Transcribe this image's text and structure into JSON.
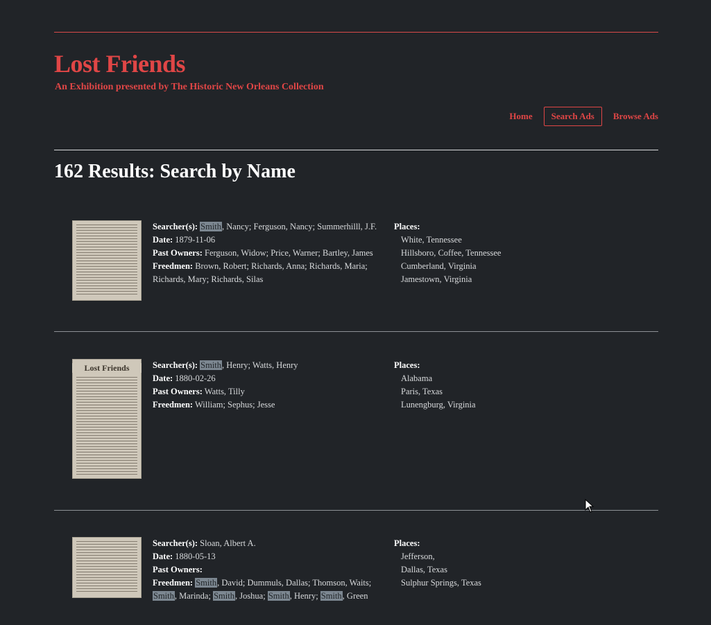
{
  "site": {
    "title": "Lost Friends",
    "subtitle": "An Exhibition presented by The Historic New Orleans Collection"
  },
  "nav": {
    "home": "Home",
    "search": "Search Ads",
    "browse": "Browse Ads"
  },
  "results_title": "162 Results: Search by Name",
  "labels": {
    "searchers": "Searcher(s):",
    "date": "Date:",
    "past_owners": "Past Owners:",
    "freedmen": "Freedmen:",
    "places": "Places:"
  },
  "results": [
    {
      "searchers_hl": "Smith",
      "searchers_rest": ", Nancy; Ferguson, Nancy; Summerhilll, J.F.",
      "date": "1879-11-06",
      "past_owners": "Ferguson, Widow; Price, Warner; Bartley, James",
      "freedmen_line1": "Brown, Robert; Richards, Anna; Richards, Maria;",
      "freedmen_line2": "Richards, Mary; Richards, Silas",
      "places": [
        "White, Tennessee",
        "Hillsboro, Coffee, Tennessee",
        "Cumberland, Virginia",
        "Jamestown, Virginia"
      ]
    },
    {
      "searchers_hl": "Smith",
      "searchers_rest": ", Henry; Watts, Henry",
      "date": "1880-02-26",
      "past_owners": "Watts, Tilly",
      "freedmen": "William; Sephus; Jesse",
      "places": [
        "Alabama",
        "Paris, Texas",
        "Lunengburg, Virginia"
      ],
      "thumb_header": "Lost Friends"
    },
    {
      "searchers": "Sloan, Albert A.",
      "date": "1880-05-13",
      "past_owners": "",
      "freedmen_hl": "Smith",
      "freedmen_rest1": ", David; Dummuls, Dallas; Thomson, Waits;",
      "freedmen_l2_a": "Smith",
      "freedmen_l2_b": ", Marinda; ",
      "freedmen_l2_c": "Smith",
      "freedmen_l2_d": ", Joshua; ",
      "freedmen_l2_e": "Smith",
      "freedmen_l2_f": ", Henry; ",
      "freedmen_l2_g": "Smith",
      "freedmen_l2_h": ", Green",
      "places": [
        "Jefferson,",
        "Dallas, Texas",
        "Sulphur Springs, Texas"
      ]
    }
  ]
}
